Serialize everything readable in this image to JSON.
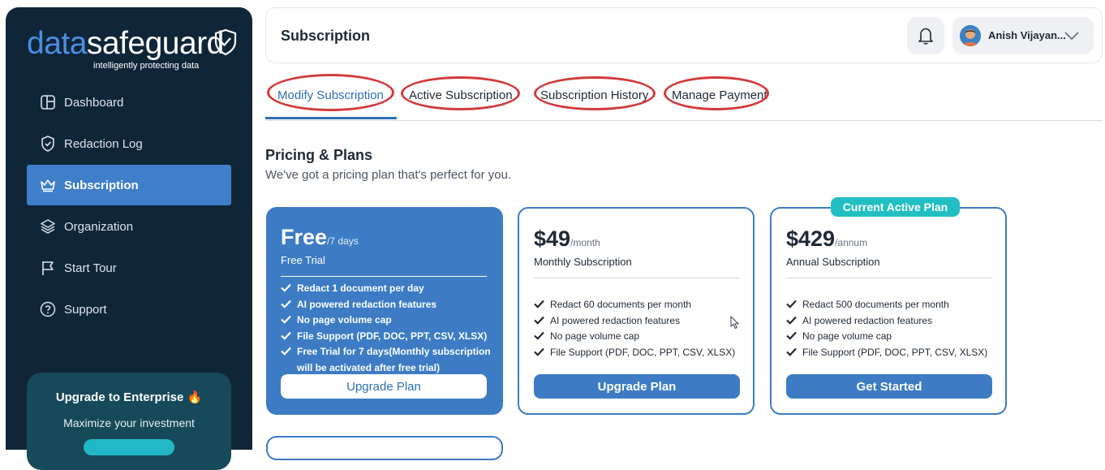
{
  "brand": {
    "logo_part1": "data",
    "logo_part2": "safeguard",
    "tagline": "intelligently  protecting data"
  },
  "sidebar": {
    "items": [
      {
        "label": "Dashboard",
        "icon": "dashboard-icon"
      },
      {
        "label": "Redaction Log",
        "icon": "shield-check-icon"
      },
      {
        "label": "Subscription",
        "icon": "crown-icon",
        "active": true
      },
      {
        "label": "Organization",
        "icon": "layers-icon"
      },
      {
        "label": "Start Tour",
        "icon": "flag-icon"
      },
      {
        "label": "Support",
        "icon": "help-circle-icon"
      }
    ],
    "upgrade": {
      "title": "Upgrade to Enterprise 🔥",
      "subtitle": "Maximize your investment"
    }
  },
  "header": {
    "title": "Subscription",
    "user_name": "Anish Vijayan..."
  },
  "tabs": [
    {
      "label": "Modify Subscription",
      "active": true
    },
    {
      "label": "Active Subscription"
    },
    {
      "label": "Subscription History"
    },
    {
      "label": "Manage Payment"
    }
  ],
  "pricing": {
    "title": "Pricing & Plans",
    "subtitle": "We've got a pricing plan that's perfect for you.",
    "plans": [
      {
        "price": "Free",
        "period": "/7 days",
        "name": "Free Trial",
        "features": [
          "Redact 1 document per day",
          "AI powered redaction features",
          "No page volume cap",
          "File Support (PDF, DOC, PPT, CSV, XLSX)",
          "Free Trial for 7 days(Monthly subscription will be activated after free trial)"
        ],
        "button": "Upgrade Plan"
      },
      {
        "price": "$49",
        "period": "/month",
        "name": "Monthly Subscription",
        "features": [
          "Redact 60 documents per month",
          "AI powered redaction features",
          "No page volume cap",
          "File Support (PDF, DOC, PPT, CSV, XLSX)"
        ],
        "button": "Upgrade Plan"
      },
      {
        "price": "$429",
        "period": "/annum",
        "name": "Annual Subscription",
        "badge": "Current Active Plan",
        "features": [
          "Redact 500 documents per month",
          "AI powered redaction features",
          "No page volume cap",
          "File Support (PDF, DOC, PPT, CSV, XLSX)"
        ],
        "button": "Get Started"
      }
    ]
  },
  "colors": {
    "sidebar_bg": "#0f2538",
    "accent": "#3d7cc4",
    "badge": "#22bfc2",
    "annotation_oval": "#d23b3b"
  }
}
